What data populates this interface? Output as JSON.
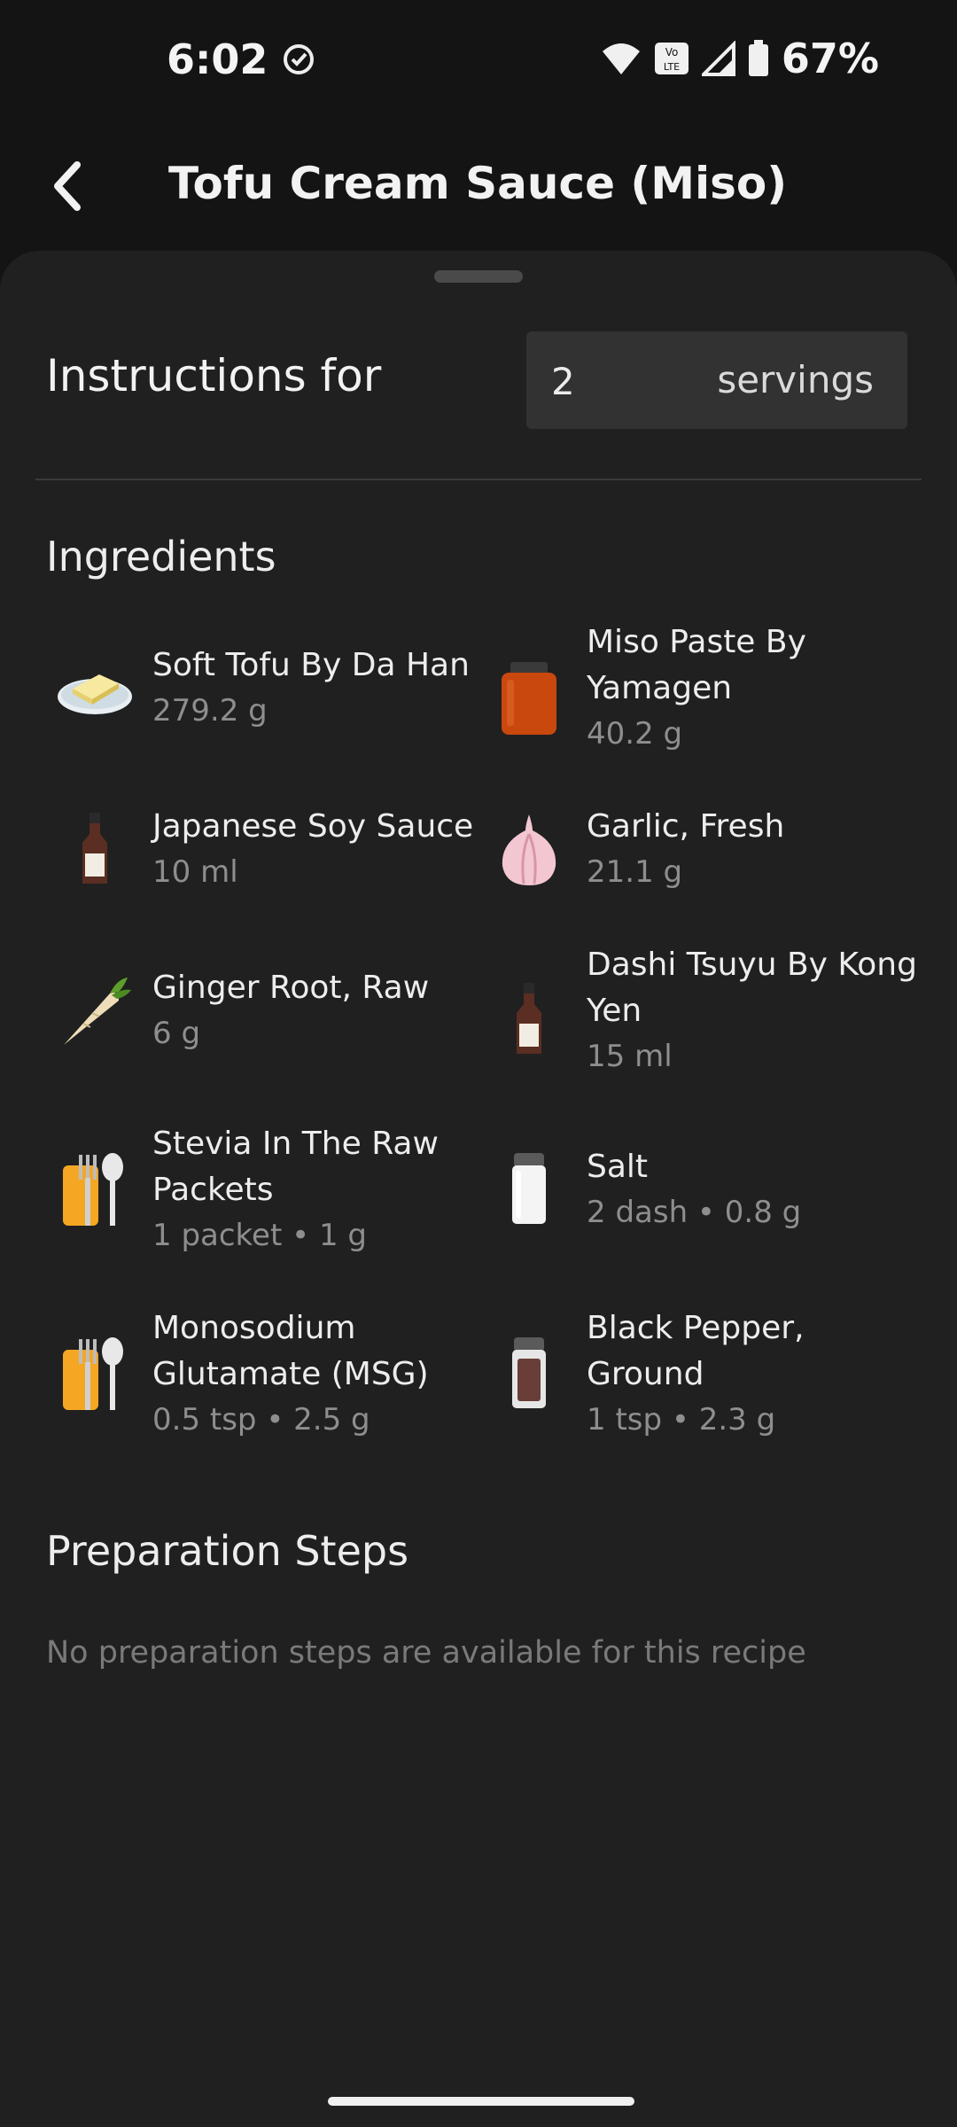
{
  "status_bar": {
    "time": "6:02",
    "battery": "67%",
    "icons": [
      "check-circle-icon",
      "wifi-icon",
      "volte-icon",
      "signal-icon",
      "battery-icon"
    ]
  },
  "app_bar": {
    "title": "Tofu Cream Sauce (Miso)",
    "back_icon": "chevron-left-icon"
  },
  "servings": {
    "label": "Instructions for",
    "value": "2",
    "suffix": "servings"
  },
  "ingredients_title": "Ingredients",
  "ingredients": [
    {
      "name": "Soft Tofu By Da Han",
      "amount": "279.2 g",
      "icon": "tofu-icon"
    },
    {
      "name": "Miso Paste By Yamagen",
      "amount": "40.2 g",
      "icon": "jar-icon"
    },
    {
      "name": "Japanese Soy Sauce",
      "amount": "10 ml",
      "icon": "sauce-bottle-icon"
    },
    {
      "name": "Garlic, Fresh",
      "amount": "21.1 g",
      "icon": "garlic-icon"
    },
    {
      "name": "Ginger Root, Raw",
      "amount": "6 g",
      "icon": "root-icon"
    },
    {
      "name": "Dashi Tsuyu By Kong Yen",
      "amount": "15 ml",
      "icon": "sauce-bottle-icon"
    },
    {
      "name": "Stevia In The Raw Packets",
      "amount": "1 packet •  1 g",
      "icon": "utensils-icon"
    },
    {
      "name": "Salt",
      "amount": "2 dash •  0.8 g",
      "icon": "salt-shaker-icon"
    },
    {
      "name": "Monosodium Glutamate (MSG)",
      "amount": "0.5 tsp •  2.5 g",
      "icon": "utensils-icon"
    },
    {
      "name": "Black Pepper, Ground",
      "amount": "1 tsp •  2.3 g",
      "icon": "pepper-shaker-icon"
    }
  ],
  "prep_title": "Preparation Steps",
  "prep_empty": "No preparation steps are available for this recipe"
}
